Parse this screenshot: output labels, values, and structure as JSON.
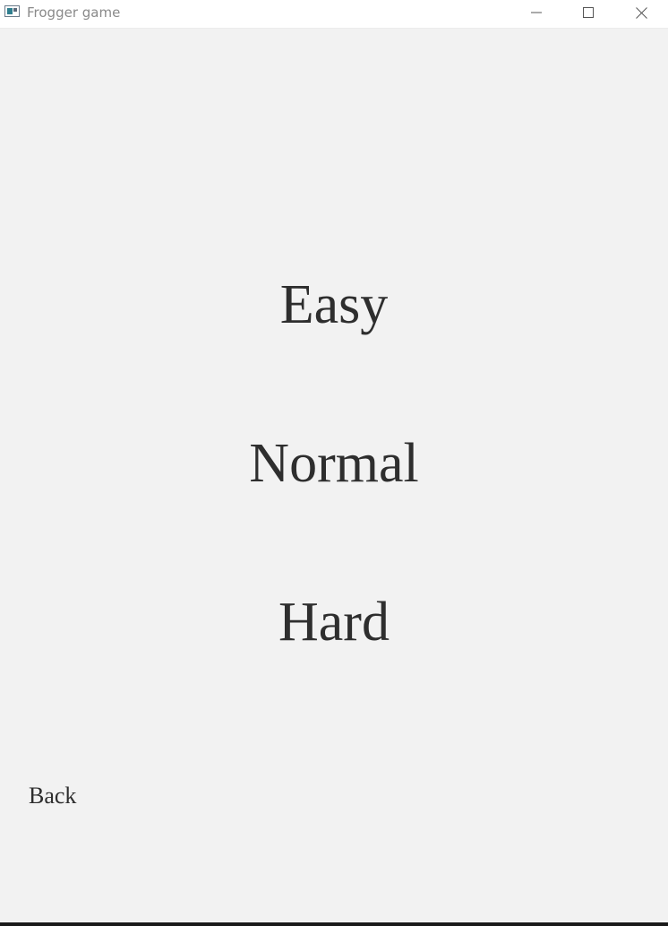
{
  "window": {
    "title": "Frogger game",
    "controls": {
      "minimize_icon": "minimize-icon",
      "maximize_icon": "maximize-icon",
      "close_icon": "close-icon"
    }
  },
  "menu": {
    "items": [
      {
        "label": "Easy"
      },
      {
        "label": "Normal"
      },
      {
        "label": "Hard"
      }
    ],
    "back_label": "Back"
  },
  "colors": {
    "background": "#f2f2f2",
    "text": "#2e2e2e",
    "titlebar": "#ffffff",
    "title_text": "#8a8a8a"
  }
}
